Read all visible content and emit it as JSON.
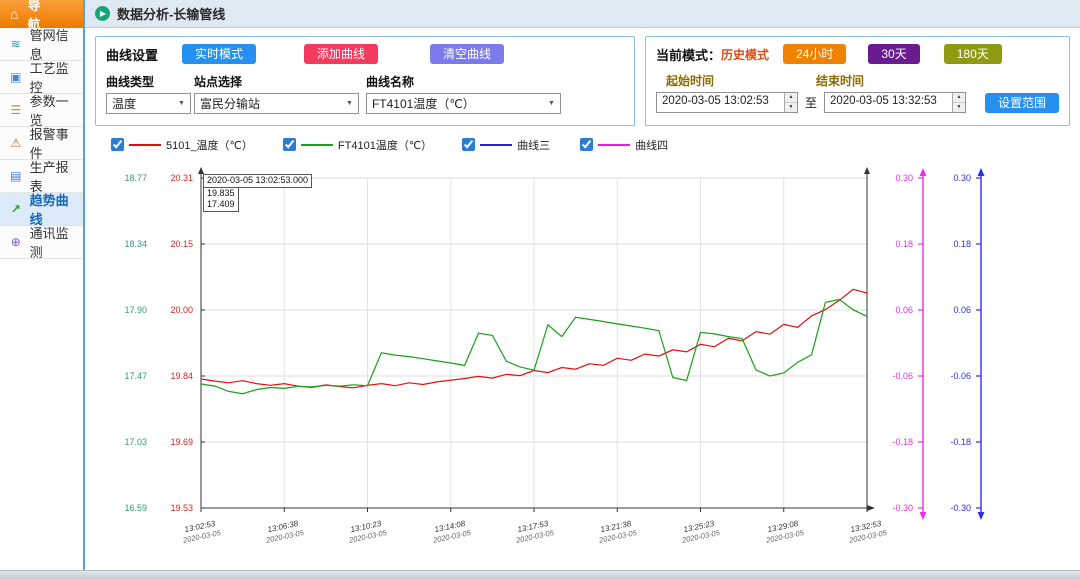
{
  "sidebar": {
    "header": {
      "label": "导 航",
      "icon": "home-icon"
    },
    "items": [
      {
        "key": "pipeline-info",
        "label": "管网信息",
        "icon": "pipe-network-icon",
        "active": false
      },
      {
        "key": "process-monitor",
        "label": "工艺监控",
        "icon": "process-monitor-icon",
        "active": false
      },
      {
        "key": "parameter-list",
        "label": "参数一览",
        "icon": "parameter-list-icon",
        "active": false
      },
      {
        "key": "alarm-events",
        "label": "报警事件",
        "icon": "alarm-icon",
        "active": false
      },
      {
        "key": "production-report",
        "label": "生产报表",
        "icon": "report-icon",
        "active": false
      },
      {
        "key": "trend-curve",
        "label": "趋势曲线",
        "icon": "trend-icon",
        "active": true
      },
      {
        "key": "comm-monitor",
        "label": "通讯监测",
        "icon": "comm-icon",
        "active": false
      }
    ]
  },
  "topbar": {
    "icon": "play-icon",
    "title": "数据分析-长输管线"
  },
  "curve_settings": {
    "title": "曲线设置",
    "realtime_button": "实时模式",
    "add_button": "添加曲线",
    "clear_button": "清空曲线",
    "type_label": "曲线类型",
    "station_label": "站点选择",
    "name_label": "曲线名称",
    "type_value": "温度",
    "station_value": "富民分输站",
    "name_value": "FT4101温度（℃）"
  },
  "mode_panel": {
    "label": "当前模式：",
    "mode_value": "历史模式",
    "btn_24h": "24小时",
    "btn_30d": "30天",
    "btn_180d": "180天",
    "start_label": "起始时间",
    "end_label": "结束时间",
    "start_value": "2020-03-05 13:02:53",
    "to_label": "至",
    "end_value": "2020-03-05 13:32:53",
    "range_button": "设置范围"
  },
  "legend": [
    {
      "label": "5101_温度（℃）",
      "color": "#e01010",
      "checked": true
    },
    {
      "label": "FT4101温度（℃）",
      "color": "#18a018",
      "checked": true
    },
    {
      "label": "曲线三",
      "color": "#2525dd",
      "checked": true
    },
    {
      "label": "曲线四",
      "color": "#e020e0",
      "checked": true
    }
  ],
  "tooltip": {
    "time": "2020-03-05 13:02:53.000",
    "v1": "19.835",
    "v2": "17.409"
  },
  "colors": {
    "header_orange": "#ee7a00",
    "accent_blue": "#2490ef",
    "pink": "#f43b5f",
    "violet": "#7b7bee",
    "orange": "#ef8200",
    "purple": "#6a1b8f",
    "olive": "#8f9a12",
    "mode_text_red": "#e04a10"
  },
  "chart_data": {
    "type": "line",
    "grid": true,
    "y_axes": [
      {
        "id": "temp_green",
        "side": "left",
        "color": "#2e9e7e",
        "min": 16.59,
        "max": 18.77,
        "ticks": [
          "18.77",
          "18.34",
          "17.90",
          "17.47",
          "17.03",
          "16.59"
        ]
      },
      {
        "id": "temp_red",
        "side": "left",
        "color": "#e02020",
        "min": 19.53,
        "max": 20.31,
        "ticks": [
          "20.31",
          "20.15",
          "20.00",
          "19.84",
          "19.69",
          "19.53"
        ]
      },
      {
        "id": "aux_magenta",
        "side": "right",
        "color": "#e830e8",
        "min": -0.3,
        "max": 0.3,
        "ticks": [
          "0.30",
          "0.18",
          "0.06",
          "-0.06",
          "-0.18",
          "-0.30"
        ]
      },
      {
        "id": "aux_blue",
        "side": "right",
        "color": "#3030e8",
        "min": -0.3,
        "max": 0.3,
        "ticks": [
          "0.30",
          "0.18",
          "0.06",
          "-0.06",
          "-0.18",
          "-0.30"
        ]
      }
    ],
    "x_ticks": [
      {
        "time": "13:02:53",
        "date": "2020-03-05"
      },
      {
        "time": "13:06:38",
        "date": "2020-03-05"
      },
      {
        "time": "13:10:23",
        "date": "2020-03-05"
      },
      {
        "time": "13:14:08",
        "date": "2020-03-05"
      },
      {
        "time": "13:17:53",
        "date": "2020-03-05"
      },
      {
        "time": "13:21:38",
        "date": "2020-03-05"
      },
      {
        "time": "13:25:23",
        "date": "2020-03-05"
      },
      {
        "time": "13:29:08",
        "date": "2020-03-05"
      },
      {
        "time": "13:32:53",
        "date": "2020-03-05"
      }
    ],
    "series": [
      {
        "name": "5101_温度（℃）",
        "color": "#e01010",
        "axis": "temp_red",
        "values": [
          19.835,
          19.83,
          19.826,
          19.831,
          19.824,
          19.82,
          19.824,
          19.818,
          19.815,
          19.821,
          19.817,
          19.814,
          19.82,
          19.824,
          19.819,
          19.826,
          19.822,
          19.828,
          19.832,
          19.836,
          19.841,
          19.837,
          19.846,
          19.843,
          19.855,
          19.85,
          19.862,
          19.858,
          19.871,
          19.867,
          19.884,
          19.879,
          19.894,
          19.889,
          19.904,
          19.899,
          19.917,
          19.911,
          19.931,
          19.925,
          19.947,
          19.941,
          19.964,
          19.957,
          19.984,
          19.999,
          20.021,
          20.047,
          20.038
        ]
      },
      {
        "name": "FT4101温度（℃）",
        "color": "#18a018",
        "axis": "temp_green",
        "values": [
          17.409,
          17.395,
          17.36,
          17.345,
          17.372,
          17.386,
          17.38,
          17.394,
          17.39,
          17.4,
          17.395,
          17.404,
          17.398,
          17.615,
          17.6,
          17.59,
          17.576,
          17.562,
          17.548,
          17.532,
          17.745,
          17.73,
          17.56,
          17.522,
          17.5,
          17.8,
          17.722,
          17.85,
          17.836,
          17.822,
          17.806,
          17.792,
          17.778,
          17.762,
          17.452,
          17.432,
          17.75,
          17.74,
          17.722,
          17.71,
          17.502,
          17.462,
          17.482,
          17.552,
          17.602,
          17.948,
          17.968,
          17.9,
          17.856
        ]
      }
    ]
  }
}
